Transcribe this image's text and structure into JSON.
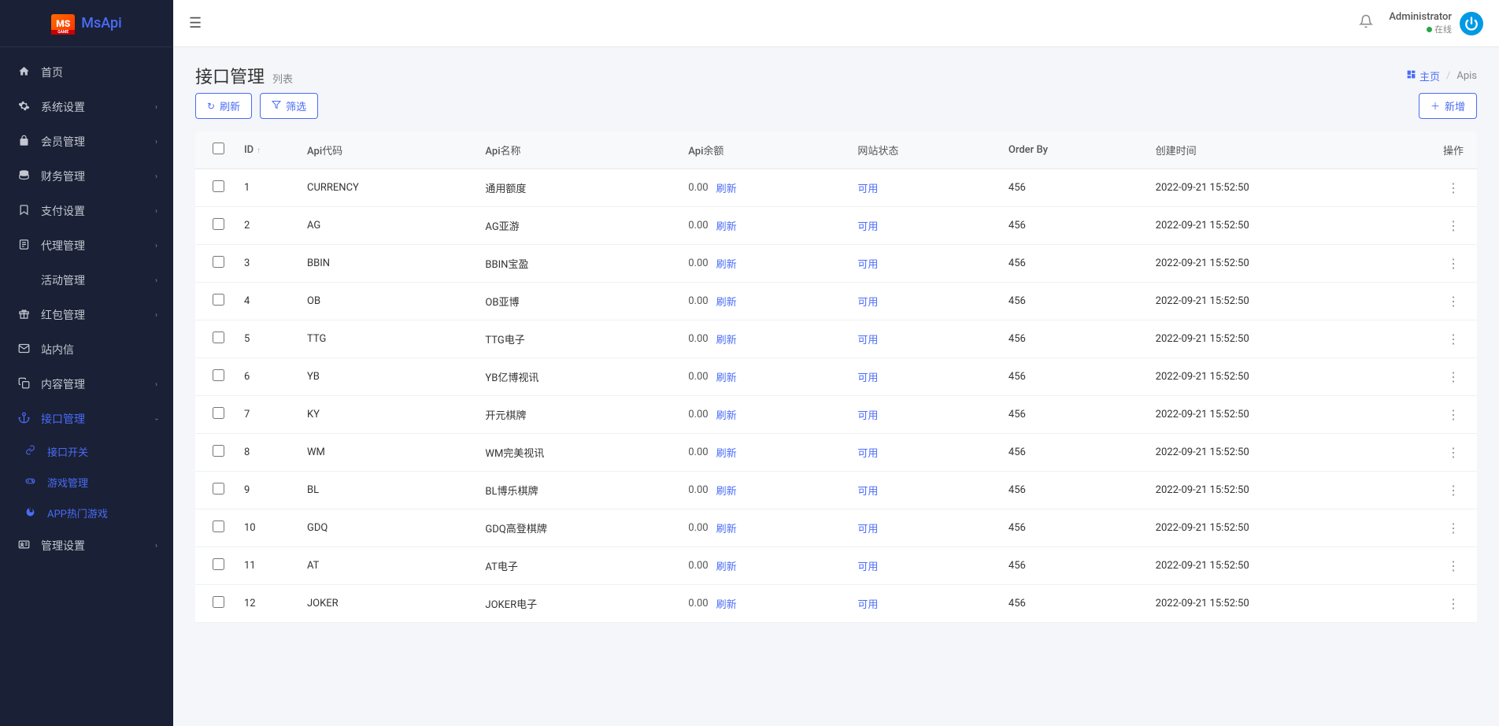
{
  "brand": {
    "logo_text": "MS",
    "name": "MsApi"
  },
  "topbar": {
    "user_name": "Administrator",
    "status_label": "在线"
  },
  "sidebar": {
    "items": [
      {
        "icon": "home",
        "label": "首页",
        "expandable": false
      },
      {
        "icon": "cogs",
        "label": "系统设置",
        "expandable": true
      },
      {
        "icon": "lock",
        "label": "会员管理",
        "expandable": true
      },
      {
        "icon": "database",
        "label": "财务管理",
        "expandable": true
      },
      {
        "icon": "bookmark",
        "label": "支付设置",
        "expandable": true
      },
      {
        "icon": "file",
        "label": "代理管理",
        "expandable": true
      },
      {
        "icon": "snowflake",
        "label": "活动管理",
        "expandable": true
      },
      {
        "icon": "gift",
        "label": "红包管理",
        "expandable": true
      },
      {
        "icon": "envelope",
        "label": "站内信",
        "expandable": false
      },
      {
        "icon": "copy",
        "label": "内容管理",
        "expandable": true
      },
      {
        "icon": "anchor",
        "label": "接口管理",
        "expandable": true,
        "active": true,
        "expanded": true,
        "children": [
          {
            "icon": "link",
            "label": "接口开关"
          },
          {
            "icon": "gamepad",
            "label": "游戏管理"
          },
          {
            "icon": "fire",
            "label": "APP热门游戏"
          }
        ]
      },
      {
        "icon": "id-card",
        "label": "管理设置",
        "expandable": true
      }
    ]
  },
  "page": {
    "title": "接口管理",
    "subtitle": "列表",
    "breadcrumb_home": "主页",
    "breadcrumb_current": "Apis"
  },
  "toolbar": {
    "refresh_label": "刷新",
    "filter_label": "筛选",
    "add_label": "新增"
  },
  "table": {
    "headers": {
      "id": "ID",
      "api_code": "Api代码",
      "api_name": "Api名称",
      "api_balance": "Api余额",
      "site_status": "网站状态",
      "order_by": "Order By",
      "created_at": "创建时间",
      "actions": "操作"
    },
    "refresh_text": "刷新",
    "status_text": "可用",
    "rows": [
      {
        "id": "1",
        "code": "CURRENCY",
        "name": "通用额度",
        "balance": "0.00",
        "order": "456",
        "created": "2022-09-21 15:52:50"
      },
      {
        "id": "2",
        "code": "AG",
        "name": "AG亚游",
        "balance": "0.00",
        "order": "456",
        "created": "2022-09-21 15:52:50"
      },
      {
        "id": "3",
        "code": "BBIN",
        "name": "BBIN宝盈",
        "balance": "0.00",
        "order": "456",
        "created": "2022-09-21 15:52:50"
      },
      {
        "id": "4",
        "code": "OB",
        "name": "OB亚博",
        "balance": "0.00",
        "order": "456",
        "created": "2022-09-21 15:52:50"
      },
      {
        "id": "5",
        "code": "TTG",
        "name": "TTG电子",
        "balance": "0.00",
        "order": "456",
        "created": "2022-09-21 15:52:50"
      },
      {
        "id": "6",
        "code": "YB",
        "name": "YB亿博视讯",
        "balance": "0.00",
        "order": "456",
        "created": "2022-09-21 15:52:50"
      },
      {
        "id": "7",
        "code": "KY",
        "name": "开元棋牌",
        "balance": "0.00",
        "order": "456",
        "created": "2022-09-21 15:52:50"
      },
      {
        "id": "8",
        "code": "WM",
        "name": "WM完美视讯",
        "balance": "0.00",
        "order": "456",
        "created": "2022-09-21 15:52:50"
      },
      {
        "id": "9",
        "code": "BL",
        "name": "BL博乐棋牌",
        "balance": "0.00",
        "order": "456",
        "created": "2022-09-21 15:52:50"
      },
      {
        "id": "10",
        "code": "GDQ",
        "name": "GDQ高登棋牌",
        "balance": "0.00",
        "order": "456",
        "created": "2022-09-21 15:52:50"
      },
      {
        "id": "11",
        "code": "AT",
        "name": "AT电子",
        "balance": "0.00",
        "order": "456",
        "created": "2022-09-21 15:52:50"
      },
      {
        "id": "12",
        "code": "JOKER",
        "name": "JOKER电子",
        "balance": "0.00",
        "order": "456",
        "created": "2022-09-21 15:52:50"
      }
    ]
  },
  "icons": {
    "home": "⌂",
    "cogs": "⚙",
    "lock": "🔒",
    "database": "≣",
    "bookmark": "⬜",
    "file": "📋",
    "snowflake": "❋",
    "gift": "🎁",
    "envelope": "✉",
    "copy": "⿻",
    "anchor": "⚓",
    "id-card": "▤",
    "link": "🔗",
    "gamepad": "🎮",
    "fire": "🔥"
  }
}
